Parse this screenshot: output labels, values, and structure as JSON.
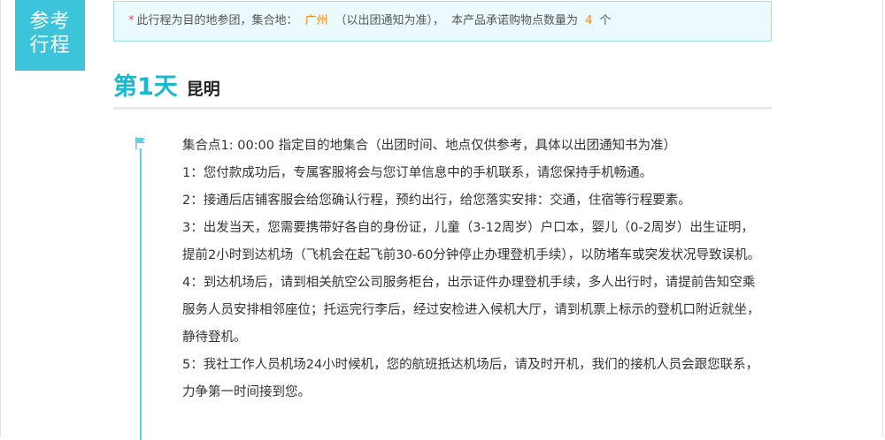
{
  "badge": {
    "line1": "参考",
    "line2": "行程"
  },
  "notice": {
    "star": "*",
    "text_before_city": "此行程为目的地参团，集合地：",
    "city": "广州",
    "city_note": "（以出团通知为准），",
    "count_prefix": "本产品承诺购物点数量为",
    "count": "4",
    "count_unit": "个"
  },
  "day": {
    "number_label": "第1天",
    "city": "昆明"
  },
  "itinerary": {
    "items": [
      "集合点1:   00:00 指定目的地集合（出团时间、地点仅供参考，具体以出团通知书为准）",
      "1：您付款成功后，专属客服将会与您订单信息中的手机联系，请您保持手机畅通。",
      "2：接通后店铺客服会给您确认行程，预约出行，给您落实安排：交通，住宿等行程要素。",
      "3：出发当天，您需要携带好各自的身份证，儿童（3-12周岁）户口本，婴儿（0-2周岁）出生证明，提前2小时到达机场（飞机会在起飞前30-60分钟停止办理登机手续），以防堵车或突发状况导致误机。",
      "4：到达机场后，请到相关航空公司服务柜台，出示证件办理登机手续，多人出行时，请提前告知空乘服务人员安排相邻座位；托运完行李后，经过安检进入候机大厅，请到机票上标示的登机口附近就坐，静待登机。",
      "5：我社工作人员机场24小时候机，您的航班抵达机场后，请及时开机，我们的接机人员会跟您联系，力争第一时间接到您。"
    ]
  },
  "icons": {
    "timeline_marker": "flag-icon"
  },
  "colors": {
    "accent": "#3cc5da",
    "day_number": "#18b9cf",
    "highlight": "#f08a24",
    "required_star": "#e64545",
    "notice_bg": "#ebfafc"
  }
}
